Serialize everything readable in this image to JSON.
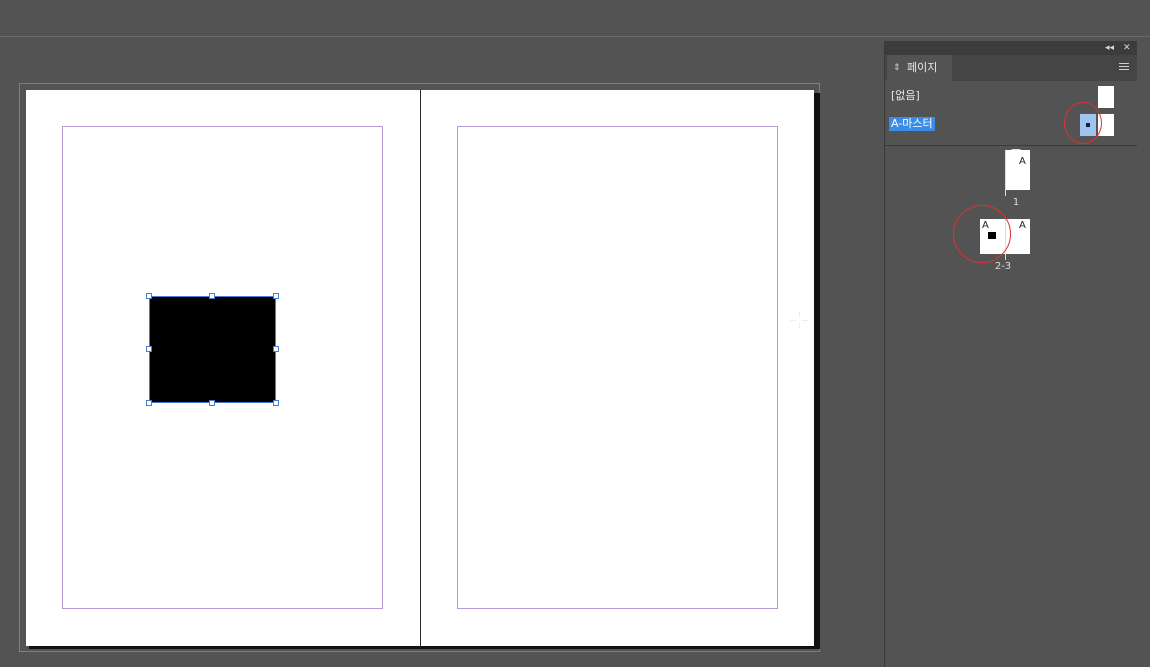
{
  "panel": {
    "tab_label": "페이지",
    "masters": [
      {
        "label": "[없음]"
      },
      {
        "label": "A-마스터",
        "selected": true
      }
    ],
    "pages": [
      {
        "number": "1",
        "master_prefix": "A"
      },
      {
        "number": "2-3",
        "left_prefix": "A",
        "right_prefix": "A"
      }
    ]
  },
  "icons": {
    "panel_tab_arrow": "updown-arrow-icon",
    "panel_menu": "hamburger-menu-icon",
    "collapse": "double-chevron-icon",
    "close": "close-icon",
    "cursor": "crosshair-icon"
  },
  "colors": {
    "selection_blue": "#3c8ce6",
    "annotation_red": "#e03030",
    "margin_guide": "#b79ad4",
    "bleed_guide": "#d05a64"
  }
}
